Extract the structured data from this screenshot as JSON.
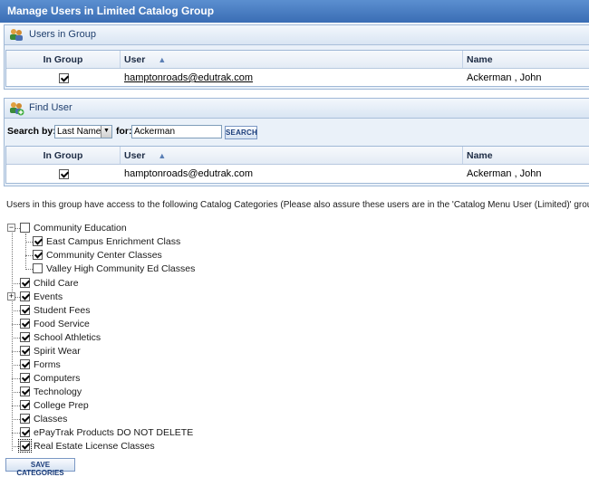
{
  "title": "Manage Users in Limited Catalog Group",
  "users_in_group": {
    "heading": "Users in Group",
    "columns": {
      "in_group": "In Group",
      "user": "User",
      "name": "Name"
    },
    "rows": [
      {
        "checked": true,
        "user": "hamptonroads@edutrak.com",
        "name": "Ackerman , John"
      }
    ]
  },
  "find_user": {
    "heading": "Find User",
    "search_by_label": "Search by:",
    "search_by_value": "Last Name",
    "for_label": "for:",
    "for_value": "Ackerman",
    "search_button": "SEARCH",
    "columns": {
      "in_group": "In Group",
      "user": "User",
      "name": "Name"
    },
    "rows": [
      {
        "checked": true,
        "user": "hamptonroads@edutrak.com",
        "name": "Ackerman , John"
      }
    ]
  },
  "notice": "Users in this group have access to the following Catalog Categories (Please also assure these users are in the 'Catalog Menu User (Limited)' group)",
  "tree": {
    "root": {
      "label": "Community Education",
      "checked": false,
      "expanded": true,
      "children": [
        {
          "label": "East Campus Enrichment Class",
          "checked": true
        },
        {
          "label": "Community Center Classes",
          "checked": true
        },
        {
          "label": "Valley High Community Ed Classes",
          "checked": false
        }
      ]
    },
    "items": [
      {
        "label": "Child Care",
        "checked": true
      },
      {
        "label": "Events",
        "checked": true,
        "collapsed": true
      },
      {
        "label": "Student Fees",
        "checked": true
      },
      {
        "label": "Food Service",
        "checked": true
      },
      {
        "label": "School Athletics",
        "checked": true
      },
      {
        "label": "Spirit Wear",
        "checked": true
      },
      {
        "label": "Forms",
        "checked": true
      },
      {
        "label": "Computers",
        "checked": true
      },
      {
        "label": "Technology",
        "checked": true
      },
      {
        "label": "College Prep",
        "checked": true
      },
      {
        "label": "Classes",
        "checked": true
      },
      {
        "label": "ePayTrak Products DO NOT DELETE",
        "checked": true
      },
      {
        "label": "Real Estate License Classes",
        "checked": true
      }
    ]
  },
  "save_button": "SAVE CATEGORIES",
  "colors": {
    "title_bar": "#3a6db4",
    "section_bg": "#eaf1f9",
    "accent": "#1b3d7a"
  },
  "icons": {
    "section_icon": "users-group-icon",
    "find_icon": "users-add-icon"
  }
}
